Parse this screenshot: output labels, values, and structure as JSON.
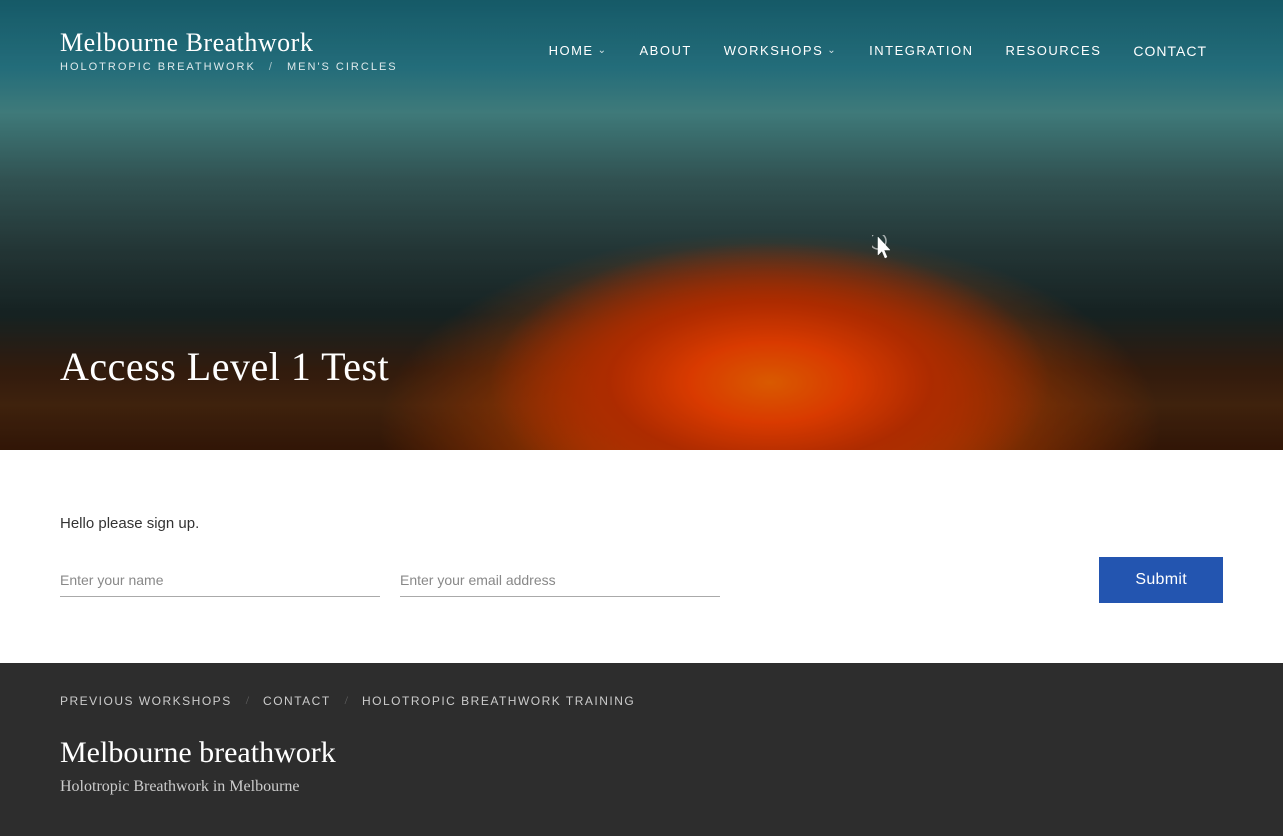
{
  "brand": {
    "name": "Melbourne Breathwork",
    "tagline1": "HOLOTROPIC BREATHWORK",
    "separator": "/",
    "tagline2": "MEN'S CIRCLES"
  },
  "nav": {
    "items": [
      {
        "label": "HOME",
        "has_dropdown": true
      },
      {
        "label": "ABOUT",
        "has_dropdown": false
      },
      {
        "label": "WORKSHOPS",
        "has_dropdown": true
      },
      {
        "label": "INTEGRATION",
        "has_dropdown": false
      },
      {
        "label": "RESOURCES",
        "has_dropdown": false
      },
      {
        "label": "CONTACT",
        "has_dropdown": false
      }
    ]
  },
  "hero": {
    "title": "Access Level 1 Test"
  },
  "form": {
    "signup_line1": "Hello please sign up.",
    "signup_line2": "Enter your name",
    "name_placeholder": "Enter your name",
    "email_placeholder": "Enter your email address",
    "submit_label": "Submit"
  },
  "footer": {
    "links": [
      {
        "label": "PREVIOUS WORKSHOPS"
      },
      {
        "label": "CONTACT"
      },
      {
        "label": "HOLOTROPIC BREATHWORK TRAINING"
      }
    ],
    "brand_name": "Melbourne breathwork",
    "tagline": "Holotropic Breathwork in Melbourne"
  }
}
